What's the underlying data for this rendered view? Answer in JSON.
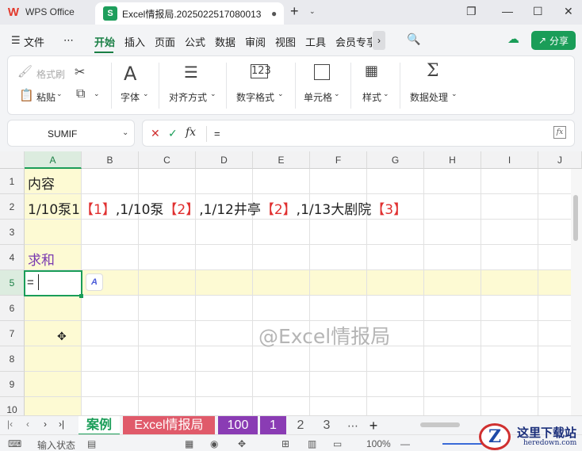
{
  "titlebar": {
    "app_name": "WPS Office",
    "doc_tab_title": "Excel情报局.2025022517080013",
    "doc_tab_dot": "●",
    "new_tab": "+",
    "tab_menu_arrow": "⌄",
    "restore": "❐",
    "minimize": "—",
    "maximize": "☐",
    "close": "✕"
  },
  "menubar": {
    "hamburger": "☰",
    "file": "文件",
    "more": "⋯",
    "items": [
      "开始",
      "插入",
      "页面",
      "公式",
      "数据",
      "审阅",
      "视图",
      "工具",
      "会员专享"
    ],
    "scroll": "›",
    "search": "🔍",
    "cloud": "☁",
    "share": "分享"
  },
  "ribbon": {
    "format_painter": "格式刷",
    "cut_icon": "✂",
    "paste": "粘贴",
    "copy_icon": "⧉",
    "font": "字体",
    "align": "对齐方式",
    "number_format": "数字格式",
    "cell": "单元格",
    "style": "样式",
    "data_process": "数据处理",
    "dropdown": "⌄"
  },
  "formula": {
    "namebox": "SUMIF",
    "namebox_arrow": "⌄",
    "cancel": "✕",
    "confirm": "✓",
    "fx": "fx",
    "content": "=",
    "expand": "fx"
  },
  "grid": {
    "columns": [
      "A",
      "B",
      "C",
      "D",
      "E",
      "F",
      "G",
      "H",
      "I",
      "J"
    ],
    "rows": [
      "1",
      "2",
      "3",
      "4",
      "5",
      "6",
      "7",
      "8",
      "9",
      "10"
    ],
    "a1": "内容",
    "a2_parts": [
      "1/10泵1",
      "【1】",
      ",1/10泵",
      "【2】",
      ",1/12井亭",
      "【2】",
      ",1/13大剧院",
      "【3】"
    ],
    "a4": "求和",
    "a5": "=",
    "ai_button": "A",
    "watermark": "@Excel情报局"
  },
  "sheets": {
    "first": "|‹",
    "prev": "‹",
    "next": "›",
    "last": "›|",
    "tabs": [
      "案例",
      "Excel情报局",
      "100",
      "1",
      "2",
      "3"
    ],
    "more": "⋯",
    "add": "+"
  },
  "status": {
    "mode_icon": "⌨",
    "mode": "输入状态",
    "zoom": "100%"
  },
  "colors": {
    "accent": "#1a9d58",
    "red_text": "#e03030",
    "purple_text": "#7a3ab0",
    "highlight": "#fdfad3"
  },
  "site_logo": {
    "text": "这里下载站",
    "url_text": "heredown.com",
    "letter": "Z"
  }
}
